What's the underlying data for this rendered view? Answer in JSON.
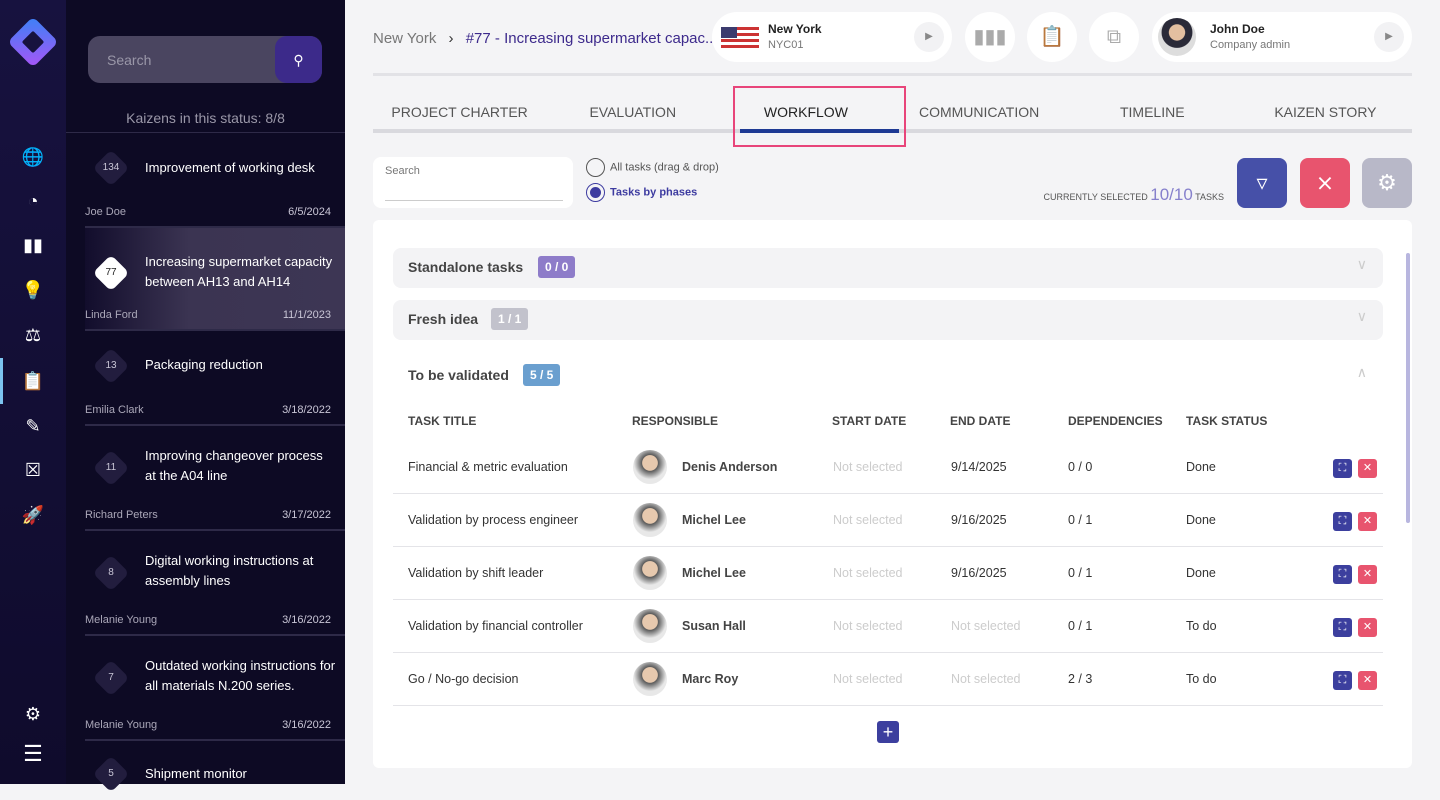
{
  "sidebar": {
    "icons": [
      "globe-pin-icon",
      "pie-chart-icon",
      "barcode-icon",
      "lightbulb-icon",
      "scales-icon",
      "clipboard-kaizen-icon",
      "edit-flash-icon",
      "clipboard-x-icon",
      "rocket-icon"
    ],
    "bottom_icons": [
      "sliders-icon",
      "menu-icon"
    ]
  },
  "list": {
    "search_placeholder": "Search",
    "count_text": "Kaizens in this status: 8/8",
    "items": [
      {
        "id": "134",
        "title": "Improvement of working desk",
        "author": "Joe Doe",
        "date": "6/5/2024"
      },
      {
        "id": "77",
        "title": "Increasing supermarket capacity between AH13 and AH14",
        "author": "Linda Ford",
        "date": "11/1/2023"
      },
      {
        "id": "13",
        "title": "Packaging reduction",
        "author": "Emilia Clark",
        "date": "3/18/2022"
      },
      {
        "id": "11",
        "title": "Improving changeover process at the A04 line",
        "author": "Richard Peters",
        "date": "3/17/2022"
      },
      {
        "id": "8",
        "title": "Digital working instructions at assembly lines",
        "author": "Melanie Young",
        "date": "3/16/2022"
      },
      {
        "id": "7",
        "title": "Outdated working instructions for all materials N.200 series.",
        "author": "Melanie Young",
        "date": "3/16/2022"
      },
      {
        "id": "5",
        "title": "Shipment monitor",
        "author": "",
        "date": ""
      }
    ]
  },
  "header": {
    "breadcrumb": [
      "New York",
      "#77 - Increasing supermarket capac..."
    ],
    "location": {
      "name": "New York",
      "code": "NYC01"
    },
    "user": {
      "name": "John Doe",
      "role": "Company admin"
    }
  },
  "tabs": [
    "PROJECT CHARTER",
    "EVALUATION",
    "WORKFLOW",
    "COMMUNICATION",
    "TIMELINE",
    "KAIZEN STORY"
  ],
  "toolbar": {
    "search_label": "Search",
    "radio_all": "All tasks (drag & drop)",
    "radio_phases": "Tasks by phases",
    "selected_prefix": "CURRENTLY SELECTED",
    "selected_count": "10/10",
    "selected_suffix": "TASKS"
  },
  "colors": {
    "filter": "#4650a8",
    "clear_filter": "#e8546e",
    "settings": "#b8b8c8",
    "accent": "#1e3a94"
  },
  "phases": [
    {
      "name": "Standalone tasks",
      "count": "0 / 0",
      "color": "#8e7cc9"
    },
    {
      "name": "Fresh idea",
      "count": "1 / 1",
      "color": "#c2c2cc"
    },
    {
      "name": "To be validated",
      "count": "5 / 5",
      "color": "#6a9fcf"
    }
  ],
  "table": {
    "headers": [
      "TASK TITLE",
      "RESPONSIBLE",
      "START DATE",
      "END DATE",
      "DEPENDENCIES",
      "TASK STATUS"
    ],
    "rows": [
      {
        "title": "Financial & metric evaluation",
        "responsible": "Denis Anderson",
        "start": "Not selected",
        "end": "9/14/2025",
        "deps": "0 / 0",
        "status": "Done"
      },
      {
        "title": "Validation by process engineer",
        "responsible": "Michel Lee",
        "start": "Not selected",
        "end": "9/16/2025",
        "deps": "0 / 1",
        "status": "Done"
      },
      {
        "title": "Validation by shift leader",
        "responsible": "Michel Lee",
        "start": "Not selected",
        "end": "9/16/2025",
        "deps": "0 / 1",
        "status": "Done"
      },
      {
        "title": "Validation by financial controller",
        "responsible": "Susan Hall",
        "start": "Not selected",
        "end": "Not selected",
        "deps": "0 / 1",
        "status": "To do"
      },
      {
        "title": "Go / No-go decision",
        "responsible": "Marc Roy",
        "start": "Not selected",
        "end": "Not selected",
        "deps": "2 / 3",
        "status": "To do"
      }
    ]
  }
}
